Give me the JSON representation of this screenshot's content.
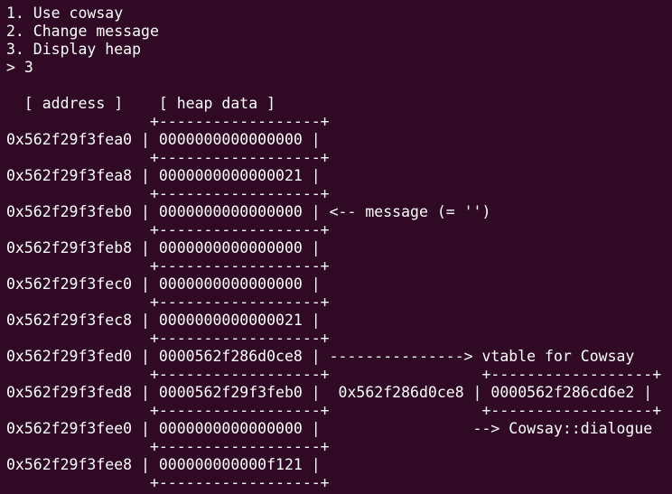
{
  "terminal": {
    "menu": [
      "1. Use cowsay",
      "2. Change message",
      "3. Display heap"
    ],
    "prompt": "> 3",
    "heap_lines": [
      "",
      "  [ address ]    [ heap data ]",
      "                +------------------+",
      "0x562f29f3fea0 | 0000000000000000 |",
      "                +------------------+",
      "0x562f29f3fea8 | 0000000000000021 |",
      "                +------------------+",
      "0x562f29f3feb0 | 0000000000000000 | <-- message (= '')",
      "                +------------------+",
      "0x562f29f3feb8 | 0000000000000000 |",
      "                +------------------+",
      "0x562f29f3fec0 | 0000000000000000 |",
      "                +------------------+",
      "0x562f29f3fec8 | 0000000000000021 |",
      "                +------------------+",
      "0x562f29f3fed0 | 0000562f286d0ce8 | ---------------> vtable for Cowsay",
      "                +------------------+                 +------------------+",
      "0x562f29f3fed8 | 0000562f29f3feb0 |  0x562f286d0ce8 | 0000562f286cd6e2 |",
      "                +------------------+                 +------------------+",
      "0x562f29f3fee0 | 0000000000000000 |                 --> Cowsay::dialogue",
      "                +------------------+",
      "0x562f29f3fee8 | 000000000000f121 |",
      "                +------------------+"
    ]
  }
}
